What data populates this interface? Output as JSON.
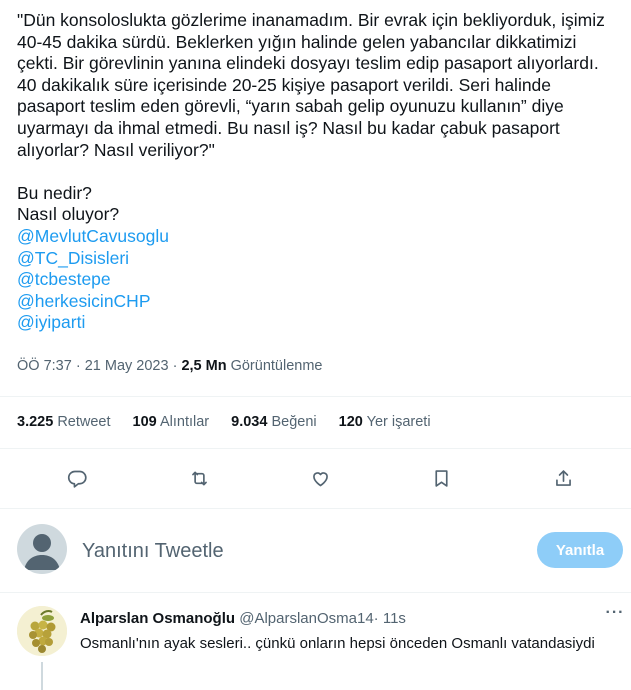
{
  "tweet": {
    "quote": "\"Dün konsoloslukta gözlerime inanamadım. Bir evrak için bekliyorduk, işimiz 40-45 dakika sürdü. Beklerken yığın halinde gelen yabancılar dikkatimizi çekti. Bir görevlinin yanına elindeki dosyayı teslim edip pasaport alıyorlardı. 40 dakikalık süre içerisinde 20-25 kişiye pasaport verildi. Seri halinde pasaport teslim eden görevli, “yarın sabah gelip oyunuzu kullanın” diye uyarmayı da ihmal etmedi. Bu nasıl iş? Nasıl bu kadar çabuk pasaport alıyorlar? Nasıl veriliyor?\"",
    "line1": "Bu nedir?",
    "line2": "Nasıl oluyor?",
    "mentions": [
      "@MevlutCavusoglu",
      "@TC_Disisleri",
      "@tcbestepe",
      "@herkesicinCHP",
      "@iyiparti"
    ]
  },
  "meta": {
    "time": "ÖÖ 7:37",
    "separator": " · ",
    "date": "21 May 2023",
    "views_count": "2,5 Mn",
    "views_label": "Görüntülenme"
  },
  "stats": [
    {
      "count": "3.225",
      "label": "Retweet"
    },
    {
      "count": "109",
      "label": "Alıntılar"
    },
    {
      "count": "9.034",
      "label": "Beğeni"
    },
    {
      "count": "120",
      "label": "Yer işareti"
    }
  ],
  "reply_box": {
    "placeholder": "Yanıtını Tweetle",
    "button": "Yanıtla"
  },
  "reply": {
    "name": "Alparslan Osmanoğlu",
    "handle": "@AlparslanOsma14",
    "dot": "·",
    "time": "11s",
    "more": "···",
    "text": "Osmanlı'nın ayak sesleri.. çünkü onların hepsi önceden Osmanlı vatandasiydi"
  },
  "colors": {
    "accent": "#1d9bf0",
    "muted": "#536471",
    "reply_button_disabled": "#8ecdf8",
    "divider": "#eff3f4"
  },
  "icons": [
    "reply-icon",
    "retweet-icon",
    "like-icon",
    "bookmark-icon",
    "share-icon",
    "user-avatar-icon",
    "more-icon"
  ]
}
